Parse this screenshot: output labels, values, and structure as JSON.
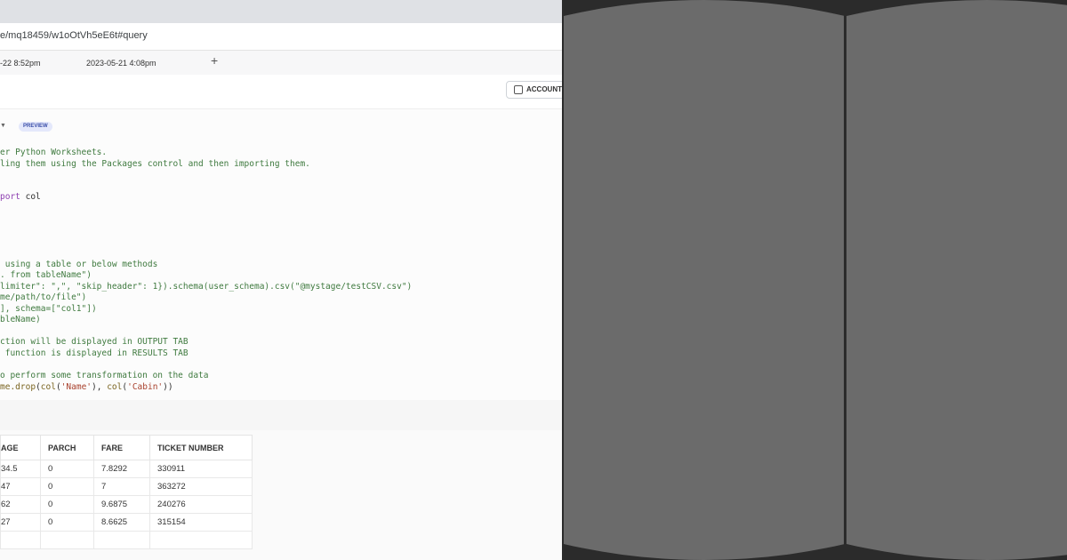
{
  "browser": {
    "url": "e/mq18459/w1oOtVh5eE6t#query"
  },
  "tabs": [
    {
      "label": "-22 8:52pm"
    },
    {
      "label": "2023-05-21 4:08pm"
    }
  ],
  "toolbar": {
    "account_label": "ACCOUNT"
  },
  "editor": {
    "preview_badge": "PREVIEW",
    "lines": [
      {
        "segments": [
          {
            "text": "er Python Worksheets.",
            "cls": "c-comment"
          }
        ]
      },
      {
        "segments": [
          {
            "text": "ling them using the Packages control and then importing them.",
            "cls": "c-comment"
          }
        ]
      },
      {
        "segments": []
      },
      {
        "segments": []
      },
      {
        "segments": [
          {
            "text": "port",
            "cls": "c-kw"
          },
          {
            "text": " col",
            "cls": ""
          }
        ]
      },
      {
        "segments": []
      },
      {
        "segments": []
      },
      {
        "segments": []
      },
      {
        "segments": []
      },
      {
        "segments": []
      },
      {
        "segments": [
          {
            "text": " using a table or below methods",
            "cls": "c-comment"
          }
        ]
      },
      {
        "segments": [
          {
            "text": ". from tableName\")",
            "cls": "c-comment"
          }
        ]
      },
      {
        "segments": [
          {
            "text": "limiter\": \",\", \"skip_header\": 1}).schema(user_schema).csv(\"@mystage/testCSV.csv\")",
            "cls": "c-comment"
          }
        ]
      },
      {
        "segments": [
          {
            "text": "me/path/to/file\")",
            "cls": "c-comment"
          }
        ]
      },
      {
        "segments": [
          {
            "text": "], schema=[\"col1\"])",
            "cls": "c-comment"
          }
        ]
      },
      {
        "segments": [
          {
            "text": "bleName)",
            "cls": "c-comment"
          }
        ]
      },
      {
        "segments": []
      },
      {
        "segments": [
          {
            "text": "ction will be displayed in OUTPUT TAB",
            "cls": "c-comment"
          }
        ]
      },
      {
        "segments": [
          {
            "text": " function is displayed in RESULTS TAB",
            "cls": "c-comment"
          }
        ]
      },
      {
        "segments": []
      },
      {
        "segments": [
          {
            "text": "o perform some transformation on the data",
            "cls": "c-comment"
          }
        ]
      },
      {
        "segments": [
          {
            "text": "me.",
            "cls": "c-method"
          },
          {
            "text": "drop",
            "cls": "c-method"
          },
          {
            "text": "(",
            "cls": ""
          },
          {
            "text": "col",
            "cls": "c-method"
          },
          {
            "text": "(",
            "cls": ""
          },
          {
            "text": "'Name'",
            "cls": "c-str"
          },
          {
            "text": "), ",
            "cls": ""
          },
          {
            "text": "col",
            "cls": "c-method"
          },
          {
            "text": "(",
            "cls": ""
          },
          {
            "text": "'Cabin'",
            "cls": "c-str"
          },
          {
            "text": "))",
            "cls": ""
          }
        ]
      }
    ]
  },
  "results": {
    "columns": [
      "AGE",
      "PARCH",
      "FARE",
      "TICKET NUMBER"
    ],
    "rows": [
      [
        "34.5",
        "0",
        "7.8292",
        "330911"
      ],
      [
        "47",
        "0",
        "7",
        "363272"
      ],
      [
        "62",
        "0",
        "9.6875",
        "240276"
      ],
      [
        "27",
        "0",
        "8.6625",
        "315154"
      ],
      [
        "",
        "",
        "",
        ""
      ]
    ]
  },
  "colors": {
    "right_background": "#2b2b2b",
    "disk": "#6b6b6b"
  }
}
